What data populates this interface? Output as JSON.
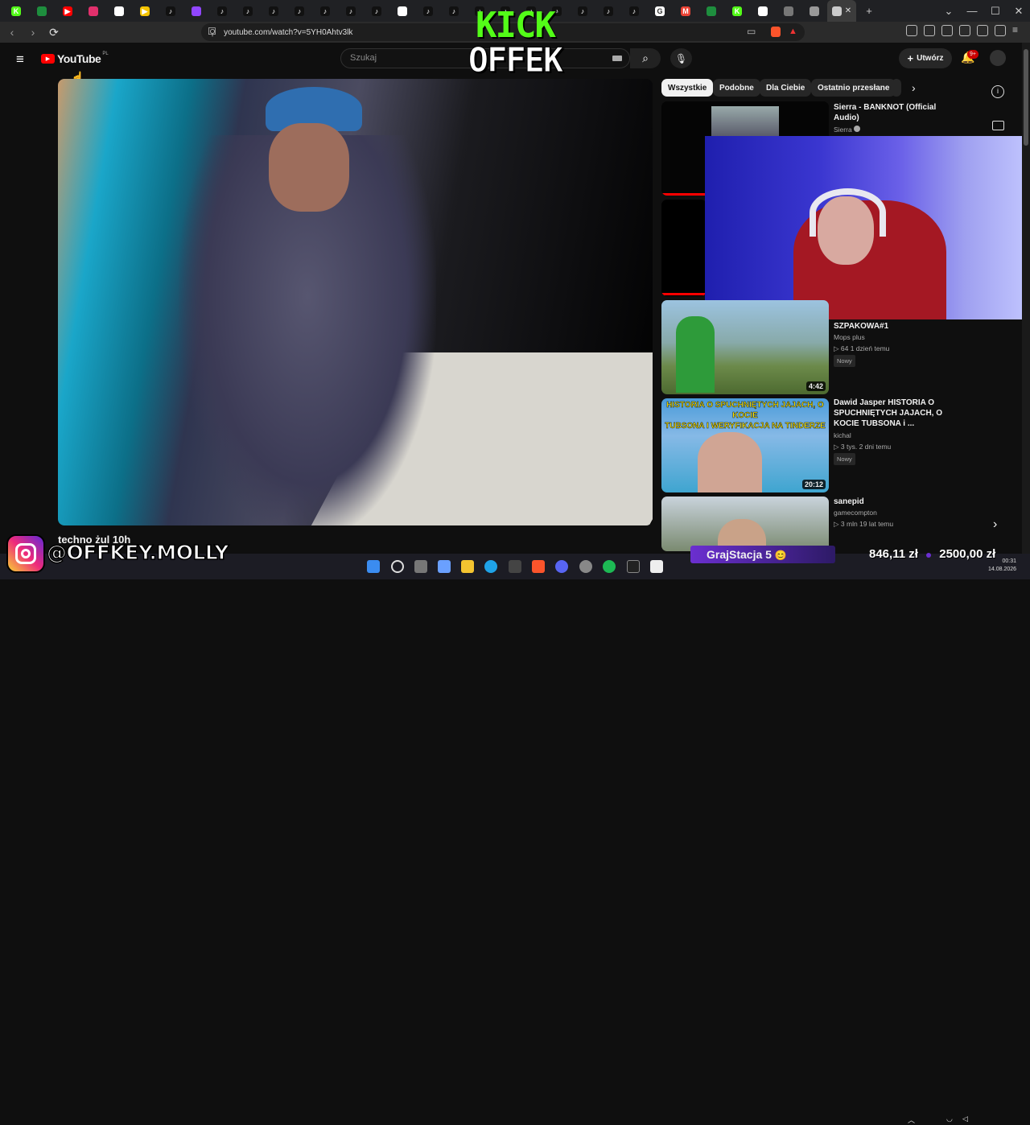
{
  "browser": {
    "tab_favicons": [
      {
        "name": "kick-favicon",
        "color": "#53fc18",
        "glyph": "K"
      },
      {
        "name": "sheets-favicon",
        "color": "#1e8e3e",
        "glyph": ""
      },
      {
        "name": "youtube-favicon",
        "color": "#ff0000",
        "glyph": "▶"
      },
      {
        "name": "instagram-favicon",
        "color": "#e1306c",
        "glyph": ""
      },
      {
        "name": "google-favicon",
        "color": "#ffffff",
        "glyph": ""
      },
      {
        "name": "yellow-app-favicon",
        "color": "#f5c400",
        "glyph": "▶"
      },
      {
        "name": "tiktok-favicon",
        "color": "#111111",
        "glyph": "♪"
      },
      {
        "name": "twitch-favicon",
        "color": "#9146ff",
        "glyph": ""
      },
      {
        "name": "tiktok-favicon",
        "color": "#111111",
        "glyph": "♪"
      },
      {
        "name": "tiktok-favicon",
        "color": "#111111",
        "glyph": "♪"
      },
      {
        "name": "tiktok-favicon",
        "color": "#111111",
        "glyph": "♪"
      },
      {
        "name": "tiktok-favicon",
        "color": "#111111",
        "glyph": "♪"
      },
      {
        "name": "tiktok-favicon",
        "color": "#111111",
        "glyph": "♪"
      },
      {
        "name": "tiktok-favicon",
        "color": "#111111",
        "glyph": "♪"
      },
      {
        "name": "tiktok-favicon",
        "color": "#111111",
        "glyph": "♪"
      },
      {
        "name": "google-favicon",
        "color": "#ffffff",
        "glyph": ""
      },
      {
        "name": "tiktok-favicon",
        "color": "#111111",
        "glyph": "♪"
      },
      {
        "name": "tiktok-favicon",
        "color": "#111111",
        "glyph": "♪"
      },
      {
        "name": "tiktok-favicon",
        "color": "#111111",
        "glyph": "♪"
      },
      {
        "name": "tiktok-favicon",
        "color": "#111111",
        "glyph": "♪"
      },
      {
        "name": "tiktok-favicon",
        "color": "#111111",
        "glyph": "♪"
      },
      {
        "name": "tiktok-favicon",
        "color": "#111111",
        "glyph": "♪"
      },
      {
        "name": "tiktok-favicon",
        "color": "#111111",
        "glyph": "♪"
      },
      {
        "name": "tiktok-favicon",
        "color": "#111111",
        "glyph": "♪"
      },
      {
        "name": "tiktok-favicon",
        "color": "#111111",
        "glyph": "♪"
      },
      {
        "name": "google-favicon",
        "color": "#ffffff",
        "glyph": "G"
      },
      {
        "name": "gmail-favicon",
        "color": "#ea4335",
        "glyph": "M"
      },
      {
        "name": "sheets-favicon",
        "color": "#1e8e3e",
        "glyph": ""
      },
      {
        "name": "kick-favicon",
        "color": "#53fc18",
        "glyph": "K"
      },
      {
        "name": "google-favicon",
        "color": "#ffffff",
        "glyph": ""
      },
      {
        "name": "globe-favicon",
        "color": "#777777",
        "glyph": ""
      },
      {
        "name": "shield-favicon",
        "color": "#999999",
        "glyph": ""
      },
      {
        "name": "chrome-favicon",
        "color": "#cccccc",
        "glyph": ""
      }
    ],
    "active_tab_close": "✕",
    "new_tab": "+",
    "url": "youtube.com/watch?v=5YH0Ahtv3lk"
  },
  "youtube": {
    "logo_text": "YouTube",
    "logo_region": "PL",
    "search_placeholder": "Szukaj",
    "create_label": "Utwórz",
    "notification_count": "9+",
    "video_title": "techno żul 10h",
    "chips": [
      "Wszystkie",
      "Podobne",
      "Dla Ciebie",
      "Ostatnio przesłane"
    ],
    "recommendations": [
      {
        "title": "Sierra - BANKNOT (Official Audio)",
        "channel": "Sierra",
        "stats": "",
        "badge": "",
        "duration": ""
      },
      {
        "title": "SZPAKOWA#1",
        "channel": "Mops plus",
        "stats": "64  1 dzień temu",
        "badge": "Nowy",
        "duration": "4:42"
      },
      {
        "title": "Dawid Jasper HISTORIA O SPUCHNIĘTYCH JAJACH, O KOCIE TUBSONA i ...",
        "channel": "kichal",
        "stats": "3 tys.  2 dni temu",
        "badge": "Nowy",
        "duration": "20:12"
      },
      {
        "title": "sanepid",
        "channel": "gamecompton",
        "stats": "3 mln  19 lat temu",
        "badge": "",
        "duration": ""
      }
    ],
    "thumb_overlay_text": [
      "HISTORIA O SPUCHNIĘTYCH JAJACH, O KOCIE",
      "TUBSONA I WERYFIKACJA NA TINDERZE"
    ]
  },
  "overlay": {
    "kick_line1": "KICK",
    "kick_line2": "OFFEK",
    "instagram_handle": "@OFFKEY.MOLLY",
    "graj_text": "GrajStacja 5",
    "money_left": "846,11 zł",
    "money_right": "2500,00 zł"
  },
  "taskbar": {
    "time": "00:31",
    "date": "14.08.2026"
  },
  "colors": {
    "kick_green": "#53fc18",
    "yt_red": "#ff0000",
    "progress_red": "#ff0000"
  }
}
